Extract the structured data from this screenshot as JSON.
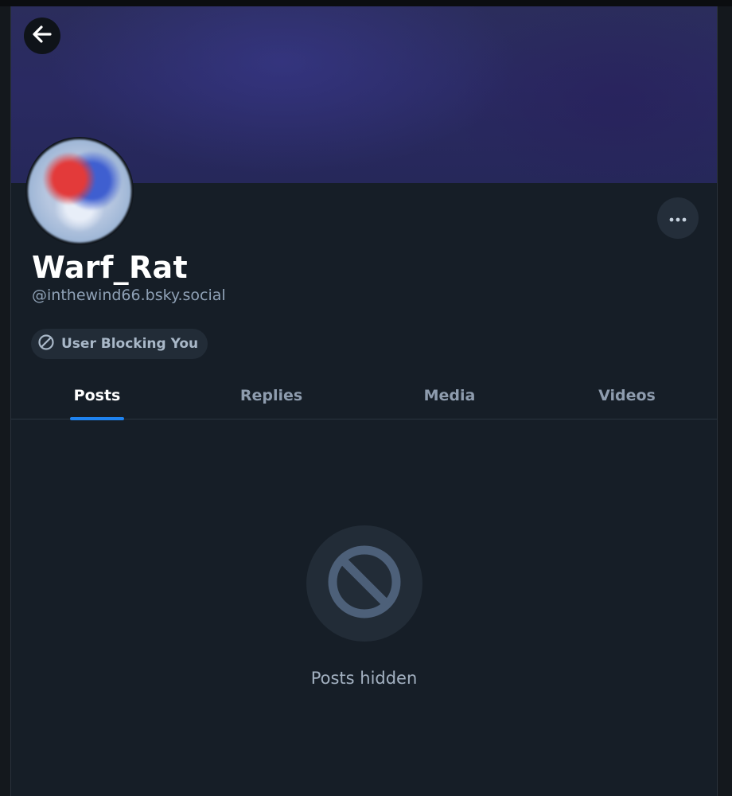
{
  "colors": {
    "background": "#161e27",
    "banner": "#2a2a62",
    "accent": "#1f83f0",
    "muted_text": "#8fa1b6"
  },
  "header": {
    "back_icon": "arrow-left-icon"
  },
  "profile": {
    "display_name": "Warf_Rat",
    "handle": "@inthewind66.bsky.social",
    "more_icon": "ellipsis-icon",
    "blocking_badge": {
      "icon": "block-icon",
      "label": "User Blocking You"
    }
  },
  "tabs": [
    {
      "label": "Posts",
      "active": true
    },
    {
      "label": "Replies",
      "active": false
    },
    {
      "label": "Media",
      "active": false
    },
    {
      "label": "Videos",
      "active": false
    }
  ],
  "feed": {
    "empty_icon": "block-icon",
    "empty_message": "Posts hidden"
  }
}
